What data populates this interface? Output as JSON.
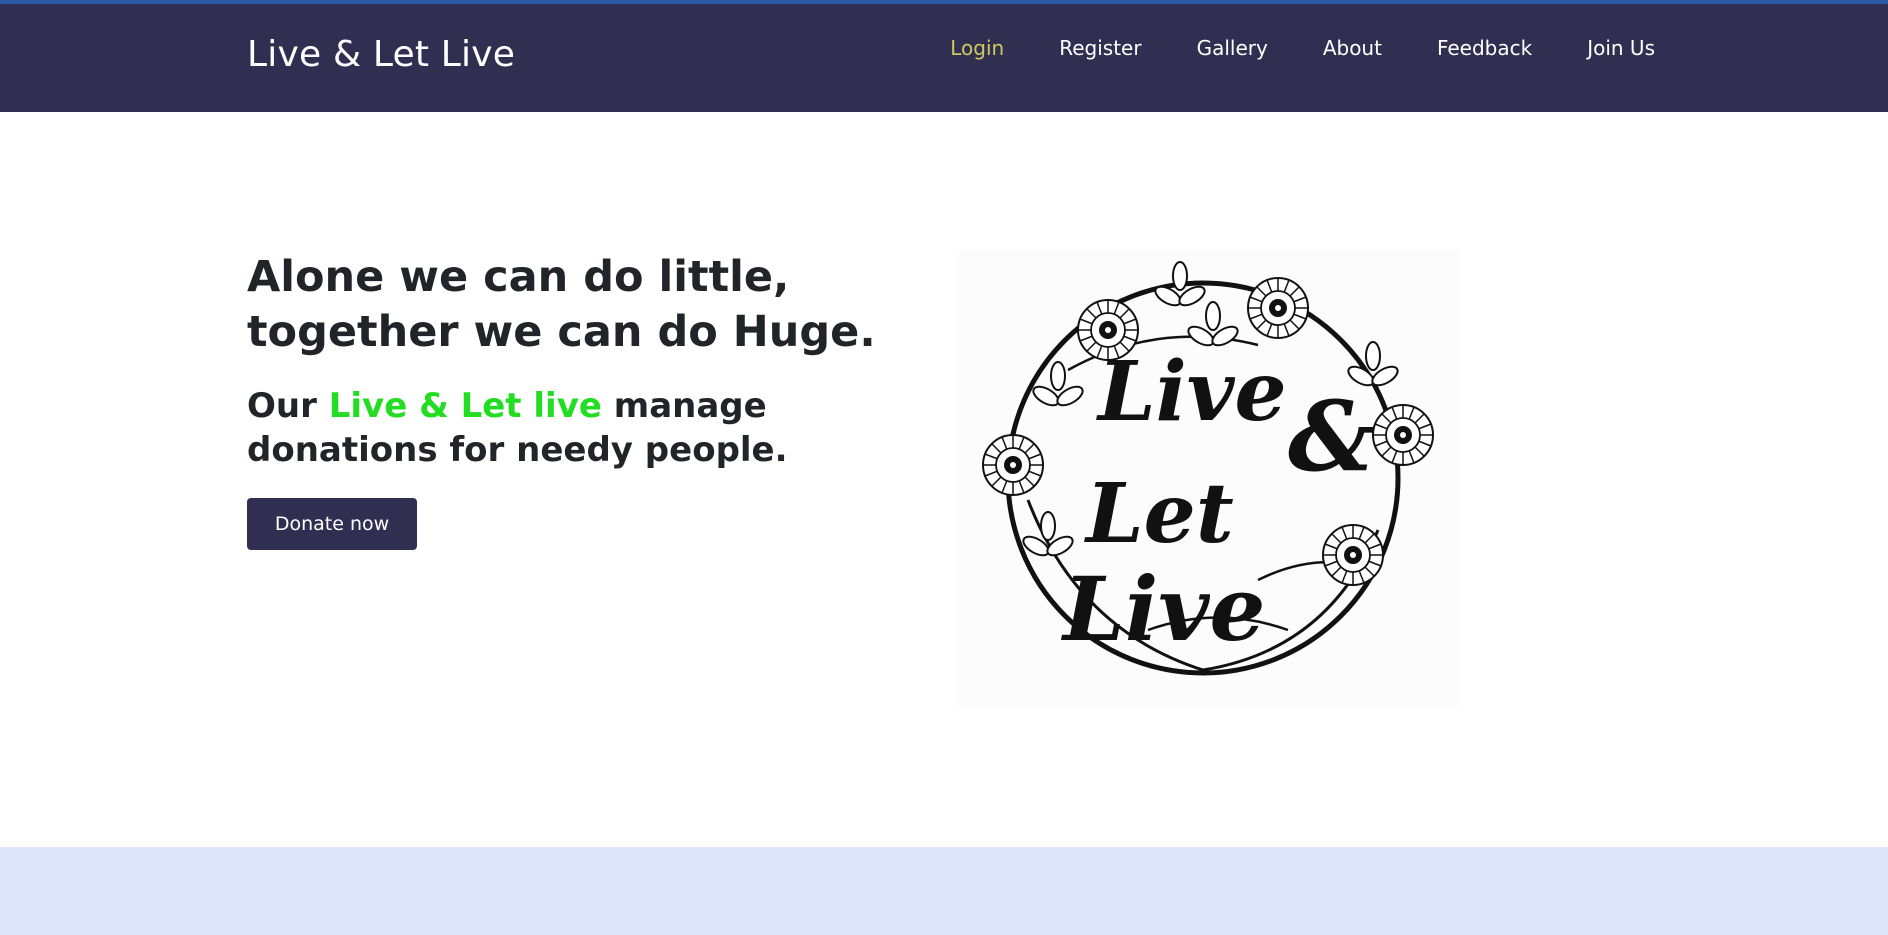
{
  "colors": {
    "navbar": "#302f52",
    "active_link": "#d0c85c",
    "highlight": "#22dd22",
    "footer_band": "#dfe6fa"
  },
  "navbar": {
    "brand": "Live & Let Live",
    "links": [
      {
        "label": "Login",
        "active": true
      },
      {
        "label": "Register"
      },
      {
        "label": "Gallery"
      },
      {
        "label": "About"
      },
      {
        "label": "Feedback"
      },
      {
        "label": "Join Us"
      }
    ]
  },
  "hero": {
    "title_line1": "Alone we can do little,",
    "title_line2": "together we can do Huge.",
    "subtitle_prefix": "Our ",
    "subtitle_highlight": "Live & Let live",
    "subtitle_suffix": " manage donations for needy people.",
    "button_label": "Donate now",
    "image": {
      "line1": "Live",
      "ampersand": "&",
      "line2": "Let",
      "line3": "Live"
    }
  }
}
